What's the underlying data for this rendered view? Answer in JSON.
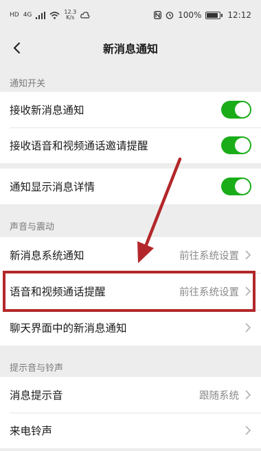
{
  "status_bar": {
    "network": "4G",
    "speed_value": "12.3",
    "speed_unit": "K/s",
    "battery": "100%",
    "battery_level": 1.0,
    "time": "12:12"
  },
  "nav": {
    "title": "新消息通知"
  },
  "sections": {
    "notify_switch": {
      "header": "通知开关",
      "items": [
        {
          "label": "接收新消息通知",
          "toggle_on": true
        },
        {
          "label": "接收语音和视频通话邀请提醒",
          "toggle_on": true
        },
        {
          "label": "通知显示消息详情",
          "toggle_on": true
        }
      ]
    },
    "sound_vibration": {
      "header": "声音与震动",
      "items": [
        {
          "label": "新消息系统通知",
          "value": "前往系统设置"
        },
        {
          "label": "语音和视频通话提醒",
          "value": "前往系统设置"
        },
        {
          "label": "聊天界面中的新消息通知",
          "value": ""
        }
      ]
    },
    "tones": {
      "header": "提示音与铃声",
      "items": [
        {
          "label": "消息提示音",
          "value": "跟随系统"
        },
        {
          "label": "来电铃声",
          "value": ""
        }
      ]
    }
  },
  "colors": {
    "toggle_on": "#1aad19",
    "annotation": "#b3272a"
  },
  "icons": [
    "back-arrow-icon",
    "chevron-right-icon",
    "wifi-icon",
    "signal-icon",
    "battery-icon",
    "nfc-icon",
    "alarm-icon"
  ]
}
